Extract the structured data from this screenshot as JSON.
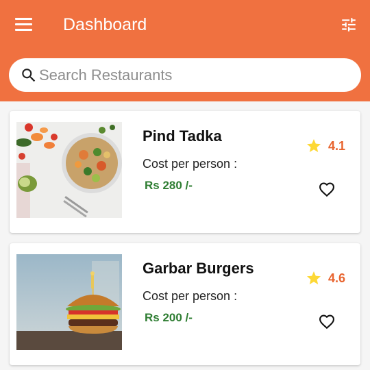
{
  "header": {
    "title": "Dashboard",
    "menu_icon": "menu-icon",
    "filter_icon": "tune-icon",
    "background_color": "#f07140"
  },
  "search": {
    "placeholder": "Search Restaurants",
    "value": "",
    "icon": "search-icon"
  },
  "restaurants": [
    {
      "name": "Pind Tadka",
      "cost_label": "Cost per person :",
      "cost": "Rs 280 /-",
      "rating": "4.1",
      "image": "salad-bowl-photo",
      "favorite": false
    },
    {
      "name": "Garbar Burgers",
      "cost_label": "Cost per person :",
      "cost": "Rs 200 /-",
      "rating": "4.6",
      "image": "burger-photo",
      "favorite": false
    }
  ],
  "colors": {
    "accent": "#f07140",
    "price": "#2e7d32",
    "rating": "#e8642f",
    "star": "#fdd835"
  }
}
